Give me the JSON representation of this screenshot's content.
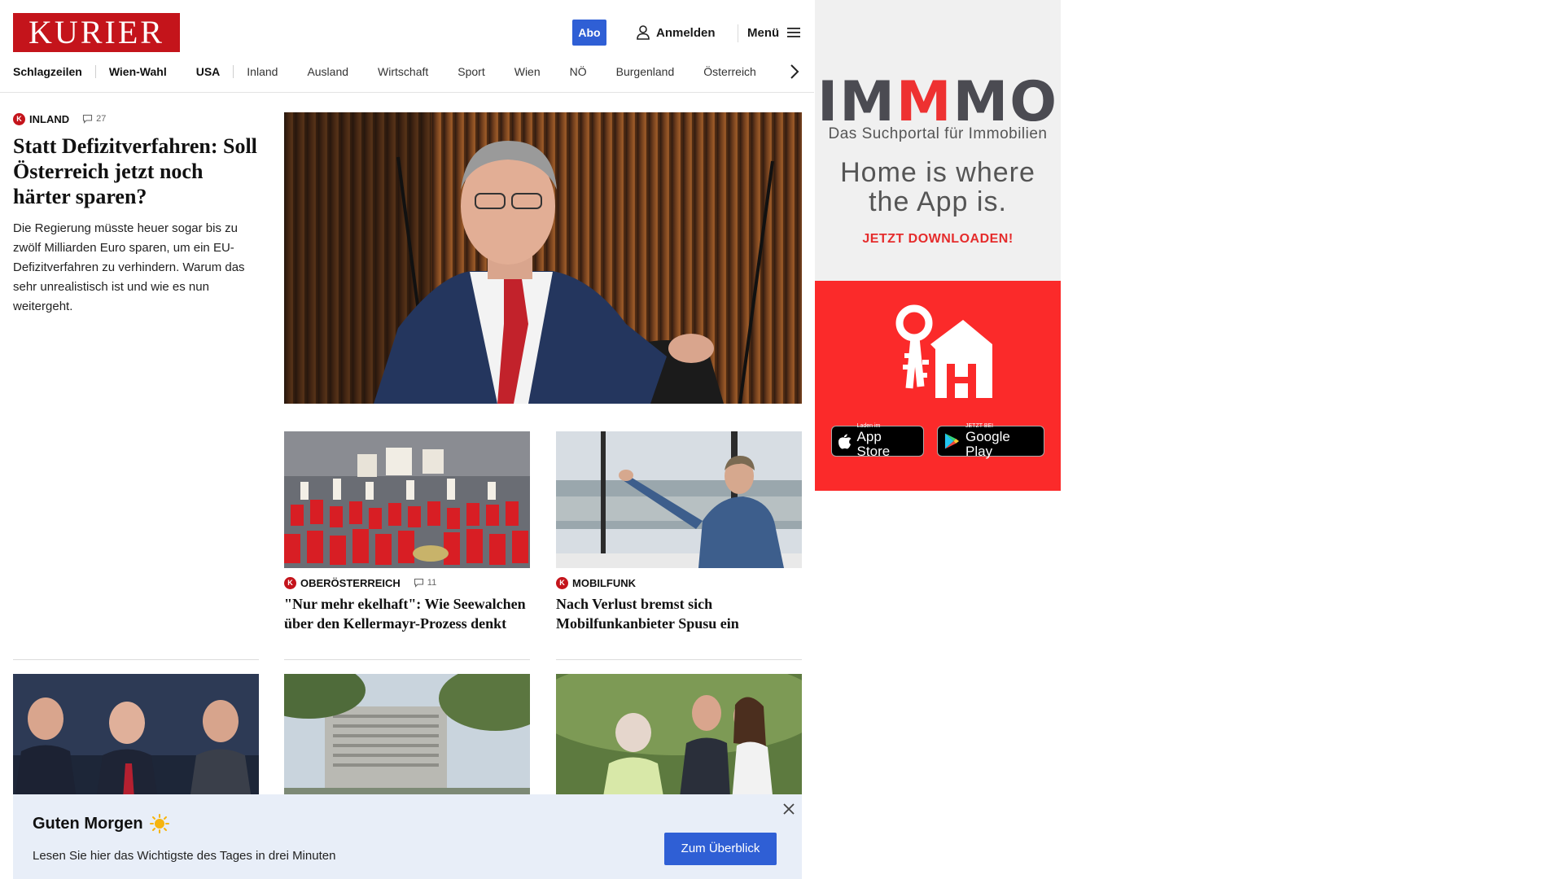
{
  "header": {
    "logo": "KURIER",
    "abo_label": "Abo",
    "login_label": "Anmelden",
    "menu_label": "Menü"
  },
  "nav": {
    "items": [
      "Schlagzeilen",
      "Wien-Wahl",
      "USA",
      "Inland",
      "Ausland",
      "Wirtschaft",
      "Sport",
      "Wien",
      "NÖ",
      "Burgenland",
      "Österreich"
    ]
  },
  "lead": {
    "category": "INLAND",
    "comments": "27",
    "title": "Statt Defizitverfahren: Soll Österreich jetzt noch härter sparen?",
    "summary": "Die Regierung müsste heuer sogar bis zu zwölf Milliarden Euro sparen, um ein EU-Defizitverfahren zu verhindern. Warum das sehr unrealistisch ist und wie es nun weitergeht."
  },
  "articles": [
    {
      "category": "OBERÖSTERREICH",
      "comments": "11",
      "title": "\"Nur mehr ekelhaft\": Wie Seewalchen über den Kellermayr-Prozess denkt"
    },
    {
      "category": "MOBILFUNK",
      "title": "Nach Verlust bremst sich Mobilfunkanbieter Spusu ein"
    }
  ],
  "ad": {
    "brand_parts": [
      "IM",
      "M",
      "MO"
    ],
    "subtitle": "Das Suchportal für Immobilien",
    "claim_line1": "Home is where",
    "claim_line2": "the App is.",
    "cta": "JETZT DOWNLOADEN!",
    "appstore_small": "Laden im",
    "appstore_big": "App Store",
    "googleplay_small": "JETZT BEI",
    "googleplay_big": "Google Play",
    "colors": {
      "brand_red": "#ee3131",
      "panel_red": "#fb2a2a"
    }
  },
  "banner": {
    "title": "Guten Morgen",
    "text": "Lesen Sie hier das Wichtigste des Tages in drei Minuten",
    "button": "Zum Überblick"
  },
  "colors": {
    "kurier_red": "#c4141b",
    "accent_blue": "#2f5fd5",
    "banner_bg": "#e8eef8"
  }
}
